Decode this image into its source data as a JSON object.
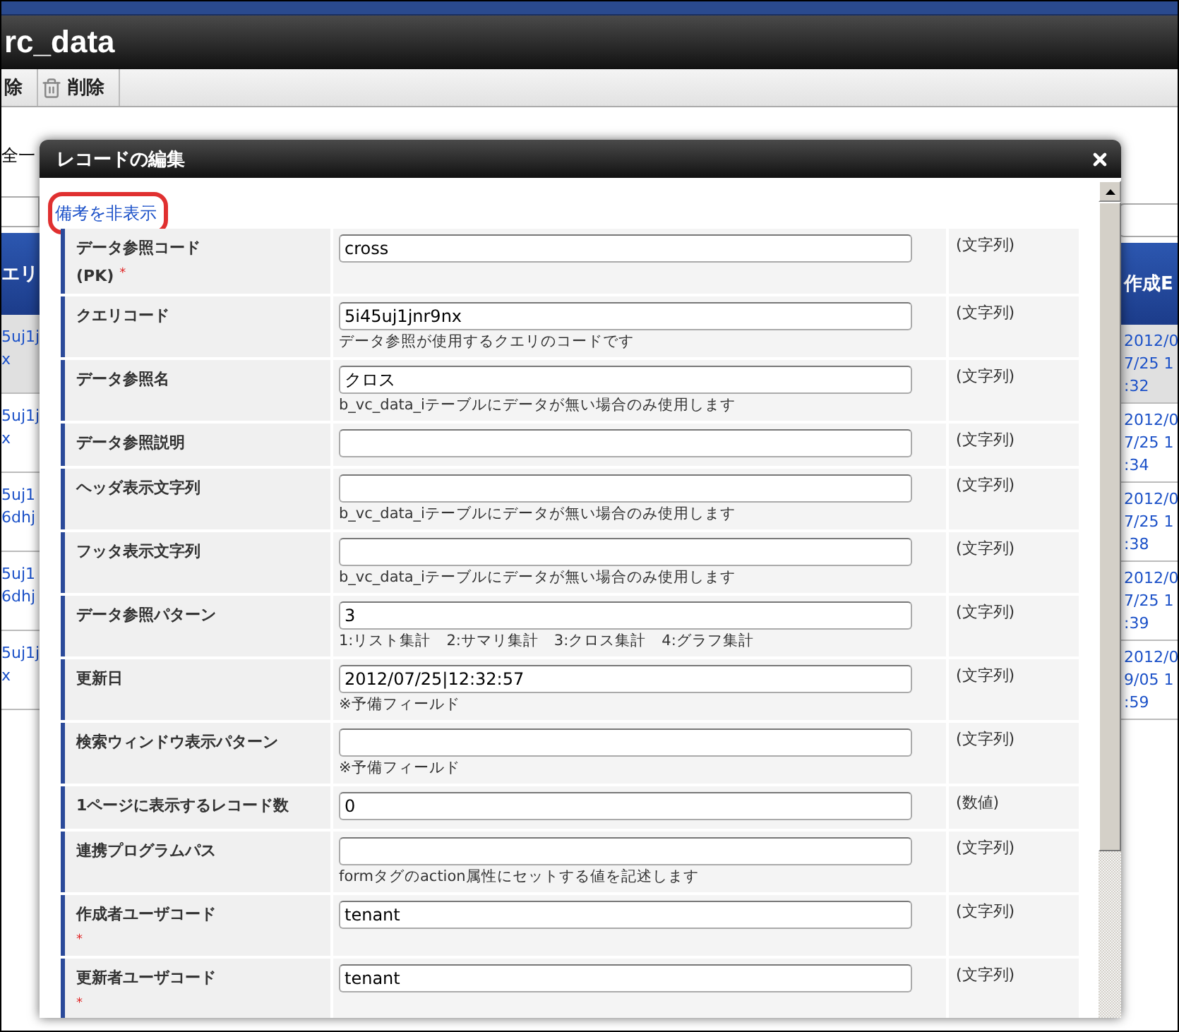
{
  "app_header": {
    "title": "rc_data"
  },
  "toolbar": {
    "buttons": [
      {
        "label": "除",
        "kind": "text"
      },
      {
        "label": "削除",
        "kind": "delete"
      }
    ]
  },
  "filter": {
    "label": "全一"
  },
  "left_table": {
    "header": "エリ",
    "rows": [
      {
        "lines": [
          "5uj1j",
          "x"
        ],
        "selected": true
      },
      {
        "lines": [
          "5uj1j",
          "x"
        ],
        "selected": false
      },
      {
        "lines": [
          "5uj1",
          "6dhj"
        ],
        "selected": false
      },
      {
        "lines": [
          "5uj1",
          "6dhj"
        ],
        "selected": false
      },
      {
        "lines": [
          "5uj1j",
          "x"
        ],
        "selected": false
      }
    ]
  },
  "right_table": {
    "header": "作成E",
    "rows": [
      [
        "2012/0",
        "7/25 1",
        ":32"
      ],
      [
        "2012/0",
        "7/25 1",
        ":34"
      ],
      [
        "2012/0",
        "7/25 1",
        ":38"
      ],
      [
        "2012/0",
        "7/25 1",
        ":39"
      ],
      [
        "2012/0",
        "9/05 1",
        ":59"
      ]
    ]
  },
  "dialog": {
    "title": "レコードの編集",
    "toggle_link": "備考を非表示",
    "fields": [
      {
        "label": "データ参照コード",
        "label_note": "(PK)",
        "required_mark": "*",
        "value": "cross",
        "type": "(文字列)"
      },
      {
        "label": "クエリコード",
        "value": "5i45uj1jnr9nx",
        "hint": "データ参照が使用するクエリのコードです",
        "type": "(文字列)"
      },
      {
        "label": "データ参照名",
        "value": "クロス",
        "hint": "b_vc_data_iテーブルにデータが無い場合のみ使用します",
        "type": "(文字列)"
      },
      {
        "label": "データ参照説明",
        "type": "(文字列)"
      },
      {
        "label": "ヘッダ表示文字列",
        "hint": "b_vc_data_iテーブルにデータが無い場合のみ使用します",
        "type": "(文字列)"
      },
      {
        "label": "フッタ表示文字列",
        "hint": "b_vc_data_iテーブルにデータが無い場合のみ使用します",
        "type": "(文字列)"
      },
      {
        "label": "データ参照パターン",
        "value": "3",
        "hint": "1:リスト集計　2:サマリ集計　3:クロス集計　4:グラフ集計",
        "type": "(文字列)"
      },
      {
        "label": "更新日",
        "value": "2012/07/25|12:32:57",
        "hint": "※予備フィールド",
        "type": "(文字列)"
      },
      {
        "label": "検索ウィンドウ表示パターン",
        "hint": "※予備フィールド",
        "type": "(文字列)"
      },
      {
        "label": "1ページに表示するレコード数",
        "value": "0",
        "type": "(数値)"
      },
      {
        "label": "連携プログラムパス",
        "hint": "formタグのaction属性にセットする値を記述します",
        "type": "(文字列)"
      },
      {
        "label": "作成者ユーザコード",
        "required_mark": "*",
        "value": "tenant",
        "type": "(文字列)"
      },
      {
        "label": "更新者ユーザコード",
        "required_mark": "*",
        "value": "tenant",
        "type": "(文字列)"
      }
    ]
  }
}
